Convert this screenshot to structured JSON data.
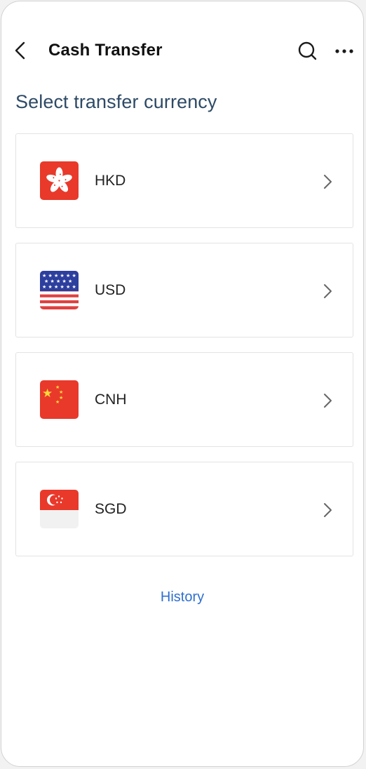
{
  "header": {
    "title": "Cash Transfer",
    "back_icon": "chevron-left-icon",
    "search_icon": "search-icon",
    "more_icon": "more-horizontal-icon"
  },
  "subtitle": "Select transfer currency",
  "currencies": [
    {
      "code": "HKD",
      "flag_icon": "hong-kong-flag-icon"
    },
    {
      "code": "USD",
      "flag_icon": "us-flag-icon"
    },
    {
      "code": "CNH",
      "flag_icon": "china-flag-icon"
    },
    {
      "code": "SGD",
      "flag_icon": "singapore-flag-icon"
    }
  ],
  "history_link": "History",
  "colors": {
    "subtitle": "#2e4a66",
    "link": "#2f6fcf",
    "card_border": "#e3e3e3",
    "flag_red": "#e8392b"
  }
}
